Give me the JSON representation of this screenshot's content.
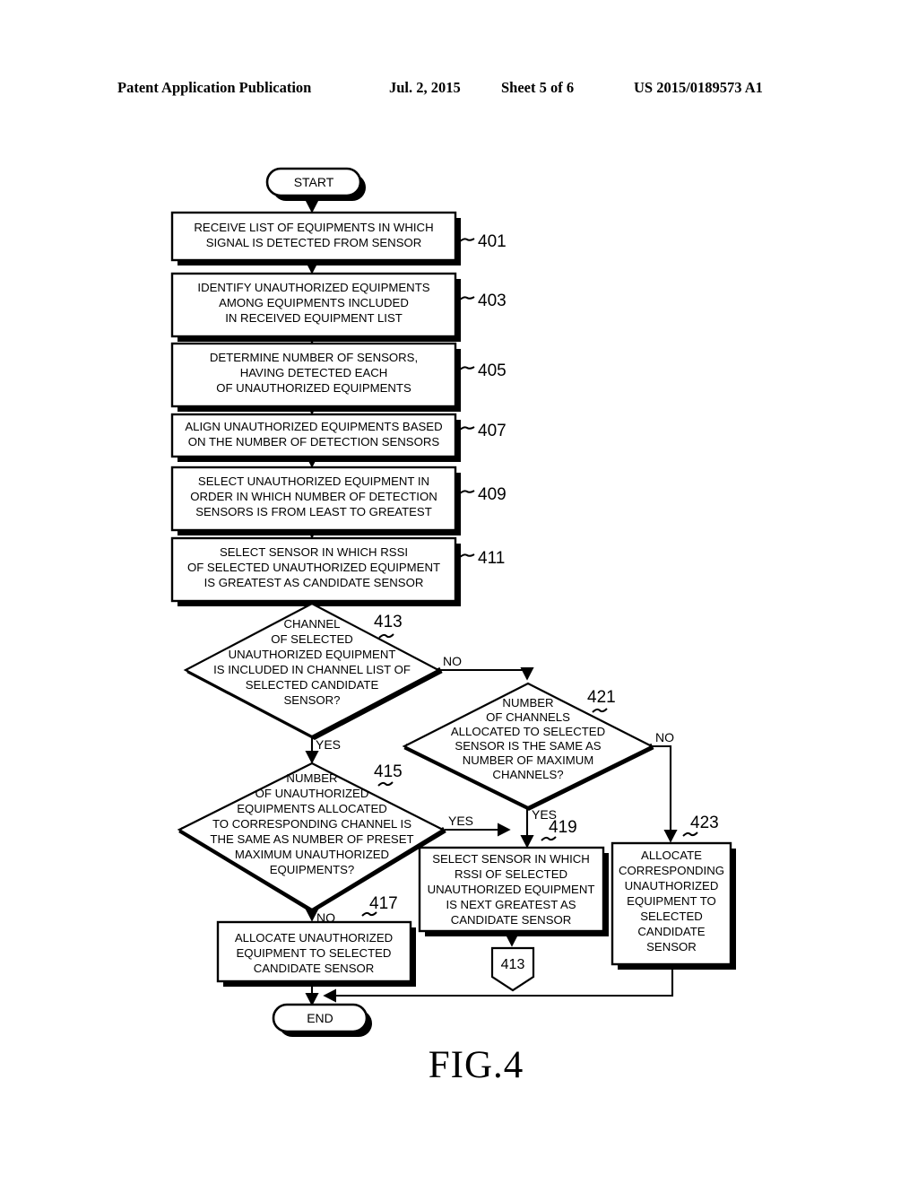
{
  "header": {
    "left": "Patent Application Publication",
    "date": "Jul. 2, 2015",
    "sheet": "Sheet 5 of 6",
    "number": "US 2015/0189573 A1"
  },
  "figure": {
    "caption": "FIG.4"
  },
  "terminals": {
    "start": "START",
    "end": "END"
  },
  "nodes": [
    {
      "ref": "401",
      "shape": "process",
      "lines": [
        "RECEIVE LIST OF EQUIPMENTS IN WHICH",
        "SIGNAL IS DETECTED FROM SENSOR"
      ]
    },
    {
      "ref": "403",
      "shape": "process",
      "lines": [
        "IDENTIFY UNAUTHORIZED EQUIPMENTS",
        "AMONG EQUIPMENTS INCLUDED",
        "IN RECEIVED EQUIPMENT LIST"
      ]
    },
    {
      "ref": "405",
      "shape": "process",
      "lines": [
        "DETERMINE NUMBER OF SENSORS,",
        "HAVING DETECTED EACH",
        "OF UNAUTHORIZED EQUIPMENTS"
      ]
    },
    {
      "ref": "407",
      "shape": "process",
      "lines": [
        "ALIGN UNAUTHORIZED EQUIPMENTS BASED",
        "ON THE NUMBER OF DETECTION SENSORS"
      ]
    },
    {
      "ref": "409",
      "shape": "process",
      "lines": [
        "SELECT UNAUTHORIZED EQUIPMENT IN",
        "ORDER IN WHICH NUMBER OF DETECTION",
        "SENSORS IS FROM LEAST TO GREATEST"
      ]
    },
    {
      "ref": "411",
      "shape": "process",
      "lines": [
        "SELECT SENSOR IN WHICH RSSI",
        "OF SELECTED UNAUTHORIZED EQUIPMENT",
        "IS GREATEST AS CANDIDATE SENSOR"
      ]
    },
    {
      "ref": "413",
      "shape": "decision",
      "lines": [
        "CHANNEL",
        "OF SELECTED",
        "UNAUTHORIZED EQUIPMENT",
        "IS INCLUDED IN CHANNEL LIST OF",
        "SELECTED CANDIDATE",
        "SENSOR?"
      ]
    },
    {
      "ref": "415",
      "shape": "decision",
      "lines": [
        "NUMBER",
        "OF UNAUTHORIZED",
        "EQUIPMENTS ALLOCATED",
        "TO CORRESPONDING CHANNEL IS",
        "THE SAME AS NUMBER OF PRESET",
        "MAXIMUM UNAUTHORIZED",
        "EQUIPMENTS?"
      ]
    },
    {
      "ref": "417",
      "shape": "process",
      "lines": [
        "ALLOCATE UNAUTHORIZED",
        "EQUIPMENT TO SELECTED",
        "CANDIDATE SENSOR"
      ]
    },
    {
      "ref": "419",
      "shape": "process",
      "lines": [
        "SELECT SENSOR IN WHICH",
        "RSSI OF SELECTED",
        "UNAUTHORIZED EQUIPMENT",
        "IS NEXT GREATEST AS",
        "CANDIDATE SENSOR"
      ]
    },
    {
      "ref": "421",
      "shape": "decision",
      "lines": [
        "NUMBER",
        "OF CHANNELS",
        "ALLOCATED TO SELECTED",
        "SENSOR IS THE SAME AS",
        "NUMBER OF MAXIMUM",
        "CHANNELS?"
      ]
    },
    {
      "ref": "423",
      "shape": "process",
      "lines": [
        "ALLOCATE",
        "CORRESPONDING",
        "UNAUTHORIZED",
        "EQUIPMENT TO",
        "SELECTED",
        "CANDIDATE",
        "SENSOR"
      ]
    }
  ],
  "edge_labels": {
    "d413_no": "NO",
    "d413_yes": "YES",
    "d415_yes": "YES",
    "d415_no": "NO",
    "d421_yes": "YES",
    "d421_no": "NO"
  },
  "connector": {
    "loop_target": "413"
  },
  "colors": {
    "ink": "#000000",
    "page": "#ffffff"
  }
}
